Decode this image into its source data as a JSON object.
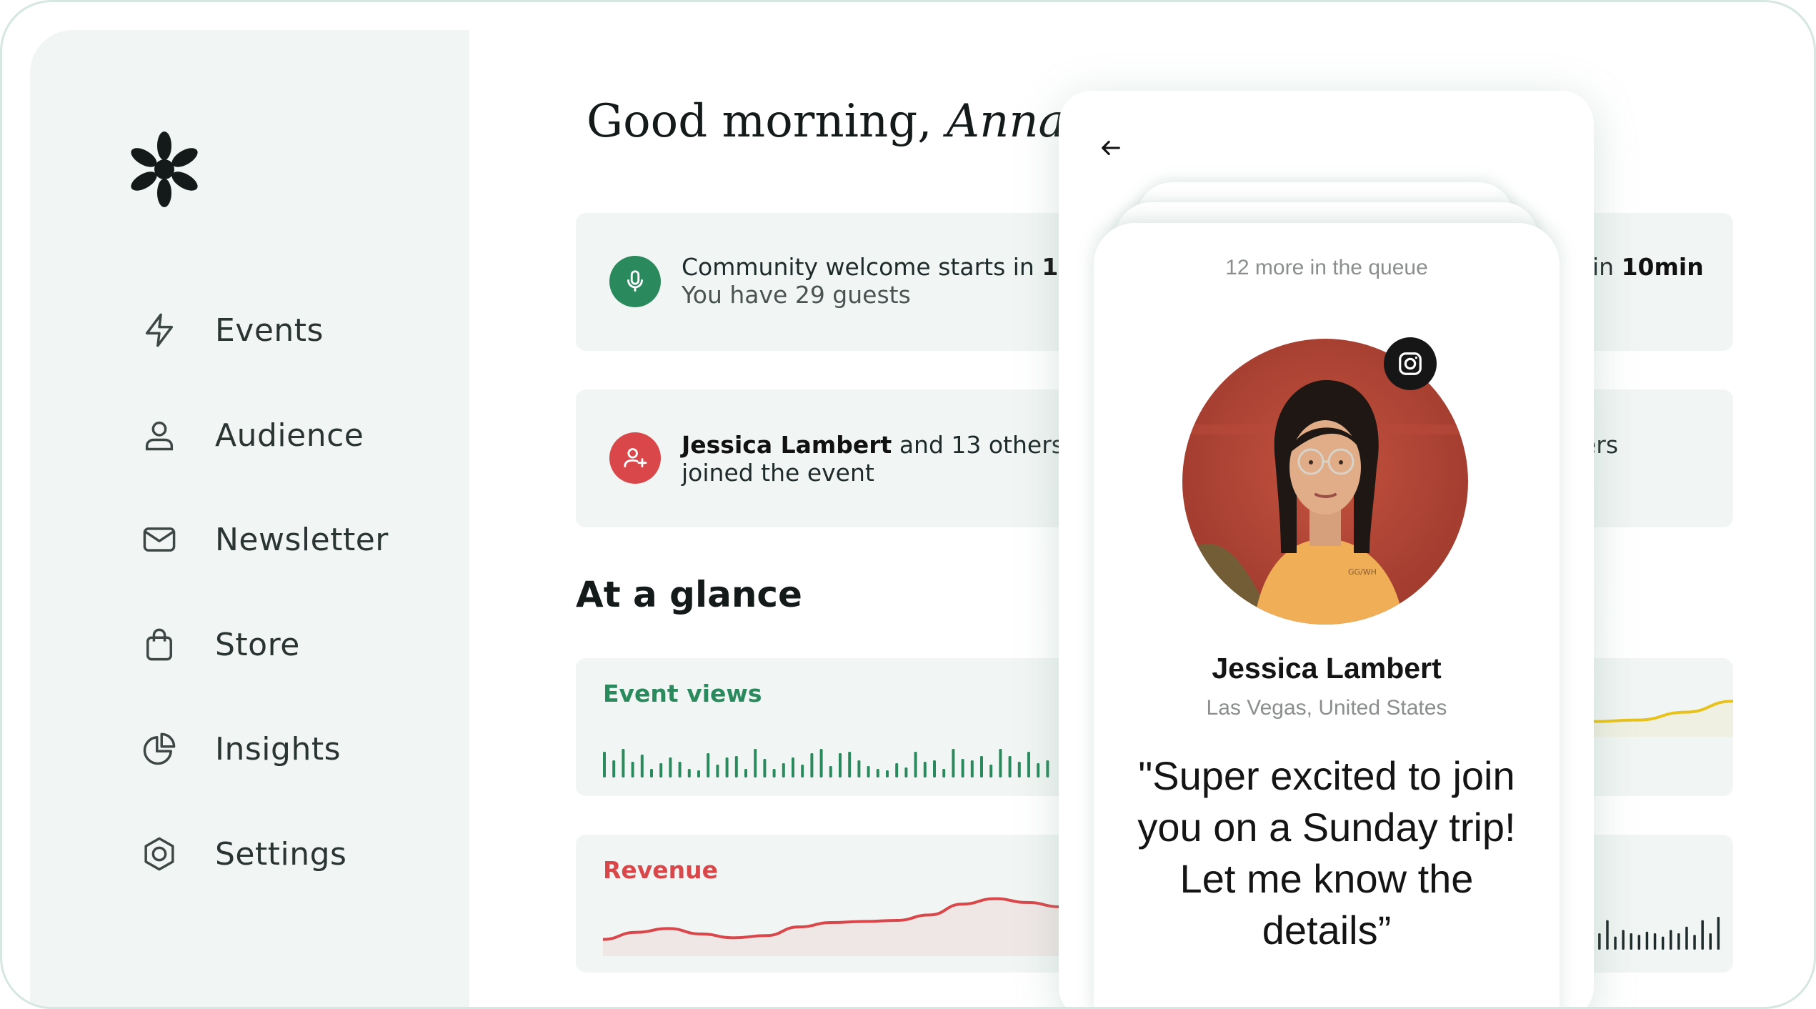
{
  "app": {
    "logo_icon": "asterisk-logo-icon",
    "colors": {
      "green": "#2a8a5e",
      "red": "#d9474a",
      "yellow": "#e8c21a",
      "sidebar_bg": "#f1f5f3"
    }
  },
  "sidebar": {
    "items": [
      {
        "label": "Events",
        "icon": "lightning-icon"
      },
      {
        "label": "Audience",
        "icon": "person-icon"
      },
      {
        "label": "Newsletter",
        "icon": "envelope-icon"
      },
      {
        "label": "Store",
        "icon": "shopping-bag-icon"
      },
      {
        "label": "Insights",
        "icon": "pie-chart-icon"
      },
      {
        "label": "Settings",
        "icon": "hexagon-settings-icon"
      }
    ]
  },
  "main": {
    "greeting": "Good morning,",
    "greeting_name": "Anna",
    "notifications": [
      {
        "line1_prefix": "Community welcome starts in",
        "line1_bold": "10min",
        "line2": "You have 29 guests",
        "icon": "microphone-icon"
      },
      {
        "line1_bold": "Jessica Lambert",
        "line1_suffix": "and 13 others",
        "line2": "joined the event",
        "icon": "add-user-icon"
      }
    ],
    "right_partial": {
      "notif1": "in",
      "notif1_bold": "10min",
      "notif2": "ers"
    },
    "section_title": "At a glance",
    "metrics": [
      {
        "label": "Event views"
      },
      {
        "label": "Revenue"
      }
    ]
  },
  "chart_data": [
    {
      "type": "bar",
      "title": "Event views",
      "values": [
        0.9,
        0.6,
        1.0,
        0.55,
        0.8,
        0.3,
        0.5,
        0.7,
        0.55,
        0.3,
        0.25,
        0.85,
        0.45,
        0.7,
        0.75,
        0.3,
        1.0,
        0.65,
        0.3,
        0.5,
        0.7,
        0.45,
        0.85,
        1.0,
        0.4,
        0.85,
        0.9,
        0.6,
        0.4,
        0.3,
        0.25,
        0.5,
        0.35,
        0.9,
        0.55,
        0.6,
        0.3,
        1.0,
        0.65,
        0.6,
        0.75,
        0.45,
        1.0,
        0.75,
        0.55,
        0.9,
        0.5,
        0.6
      ]
    },
    {
      "type": "line",
      "title": "Revenue",
      "values": [
        0.15,
        0.28,
        0.35,
        0.25,
        0.18,
        0.22,
        0.38,
        0.46,
        0.48,
        0.5,
        0.6,
        0.8,
        0.9,
        0.83,
        0.75
      ]
    },
    {
      "type": "line",
      "title": "",
      "values": [
        0.3,
        0.35,
        0.6,
        0.95
      ]
    },
    {
      "type": "bar",
      "title": "",
      "values": [
        0.7,
        0.5,
        0.9,
        0.4,
        0.6,
        0.5,
        0.45,
        0.55,
        0.5,
        0.4,
        0.6,
        0.5,
        0.7,
        0.45,
        0.9,
        0.5,
        1.0
      ]
    }
  ],
  "phone": {
    "queue_text": "12 more in the queue",
    "name": "Jessica Lambert",
    "location": "Las Vegas, United States",
    "quote_lines": [
      "\"Super excited to join",
      "you on a Sunday trip!",
      "Let me know the",
      "details”"
    ],
    "badge_icon": "instagram-icon",
    "back_icon": "back-arrow-icon"
  }
}
